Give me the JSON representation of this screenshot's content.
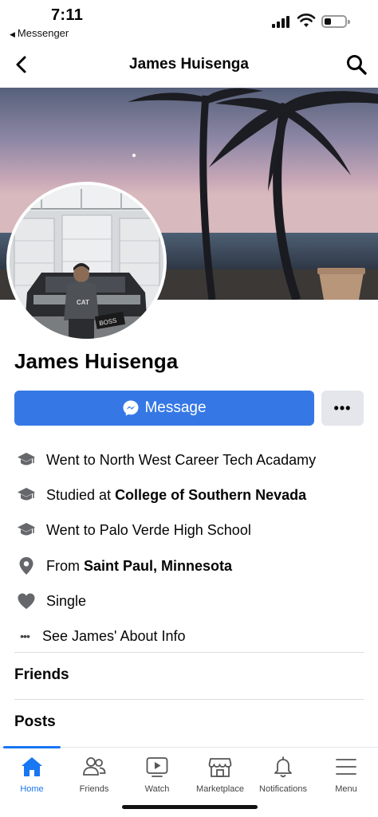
{
  "status_bar": {
    "time": "7:11",
    "back_app": "Messenger"
  },
  "header": {
    "title": "James Huisenga"
  },
  "profile": {
    "name": "James Huisenga",
    "avatar_sign_text": "BOSS"
  },
  "actions": {
    "message_label": "Message",
    "more_label": "•••"
  },
  "intro": [
    {
      "icon": "graduation-cap-icon",
      "prefix": "Went to North West Career Tech Acadamy",
      "bold": ""
    },
    {
      "icon": "graduation-cap-icon",
      "prefix": "Studied at ",
      "bold": "College of Southern Nevada"
    },
    {
      "icon": "graduation-cap-icon",
      "prefix": "Went to Palo Verde High School",
      "bold": ""
    },
    {
      "icon": "location-pin-icon",
      "prefix": "From ",
      "bold": "Saint Paul, Minnesota"
    },
    {
      "icon": "heart-icon",
      "prefix": "Single",
      "bold": ""
    }
  ],
  "about_link": {
    "dots": "•••",
    "label": "See James' About Info"
  },
  "sections": {
    "friends": "Friends",
    "posts": "Posts"
  },
  "tabs": [
    {
      "label": "Home",
      "icon": "home-icon",
      "active": true
    },
    {
      "label": "Friends",
      "icon": "friends-icon",
      "active": false
    },
    {
      "label": "Watch",
      "icon": "watch-icon",
      "active": false
    },
    {
      "label": "Marketplace",
      "icon": "marketplace-icon",
      "active": false
    },
    {
      "label": "Notifications",
      "icon": "bell-icon",
      "active": false
    },
    {
      "label": "Menu",
      "icon": "menu-icon",
      "active": false
    }
  ],
  "colors": {
    "accent": "#1877f2",
    "message_button": "#3578e5",
    "secondary_button": "#e4e6eb",
    "icon_gray": "#65676b"
  }
}
